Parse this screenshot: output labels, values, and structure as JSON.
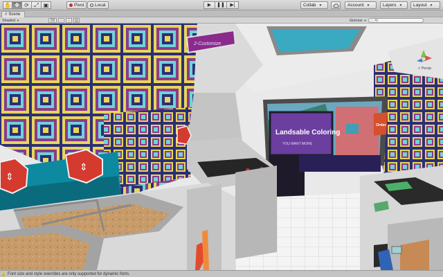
{
  "toolbar": {
    "transform_tools": [
      "hand-tool-icon",
      "move-tool-icon",
      "rotate-tool-icon",
      "scale-tool-icon",
      "rect-tool-icon"
    ],
    "pivot_label": "Pivot",
    "local_label": "Local",
    "play_buttons": [
      "play-icon",
      "pause-icon",
      "step-icon"
    ],
    "collab_label": "Collab",
    "account_label": "Account",
    "layers_label": "Layers",
    "layout_label": "Layout"
  },
  "scene_tab": {
    "label": "Scene"
  },
  "scene_options": {
    "shading_mode": "Shaded",
    "mode_2d": "2D",
    "gizmos_label": "Gizmos",
    "search_placeholder": "All"
  },
  "viewport": {
    "sign_customize": "2-Customize",
    "game_screen_title": "Landsable Coloring",
    "game_screen_subtitle": "YOU WANT MORE",
    "red_sign": "Order",
    "gizmo_label": "< Persp"
  },
  "status": {
    "message": "Font size and style overrides are only supported for dynamic fonts."
  },
  "colors": {
    "toolbar": "#d2d2d2",
    "wall_navy": "#2c2e78",
    "wall_purple": "#8c3a8a",
    "wall_yellow": "#e6d65a",
    "wall_cyan": "#6ed4d8",
    "sign_purple": "#8c2a8c",
    "red": "#d53a2f"
  }
}
